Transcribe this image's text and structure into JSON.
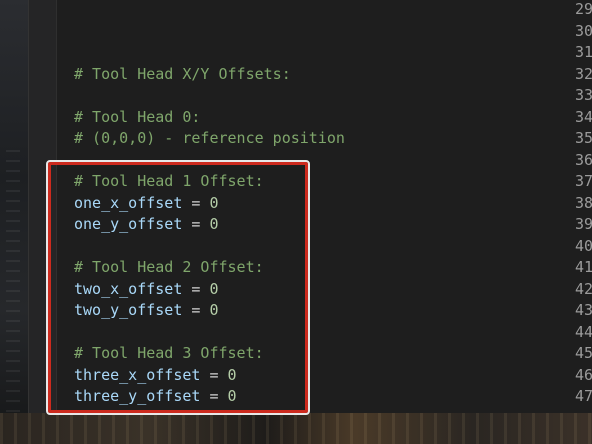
{
  "editor": {
    "lines": [
      {
        "num": "29",
        "kind": "empty",
        "text": ""
      },
      {
        "num": "30",
        "kind": "empty",
        "text": ""
      },
      {
        "num": "31",
        "kind": "empty",
        "text": ""
      },
      {
        "num": "32",
        "kind": "comment",
        "text": "# Tool Head X/Y Offsets:"
      },
      {
        "num": "33",
        "kind": "empty",
        "text": ""
      },
      {
        "num": "34",
        "kind": "comment",
        "text": "# Tool Head 0:"
      },
      {
        "num": "35",
        "kind": "comment",
        "text": "# (0,0,0) - reference position"
      },
      {
        "num": "36",
        "kind": "empty",
        "text": ""
      },
      {
        "num": "37",
        "kind": "comment",
        "text": "# Tool Head 1 Offset:"
      },
      {
        "num": "38",
        "kind": "assign",
        "name": "one_x_offset",
        "op": " = ",
        "value": "0"
      },
      {
        "num": "39",
        "kind": "assign",
        "name": "one_y_offset",
        "op": " = ",
        "value": "0"
      },
      {
        "num": "40",
        "kind": "empty",
        "text": ""
      },
      {
        "num": "41",
        "kind": "comment",
        "text": "# Tool Head 2 Offset:"
      },
      {
        "num": "42",
        "kind": "assign",
        "name": "two_x_offset",
        "op": " = ",
        "value": "0"
      },
      {
        "num": "43",
        "kind": "assign",
        "name": "two_y_offset",
        "op": " = ",
        "value": "0"
      },
      {
        "num": "44",
        "kind": "empty",
        "text": ""
      },
      {
        "num": "45",
        "kind": "comment",
        "text": "# Tool Head 3 Offset:"
      },
      {
        "num": "46",
        "kind": "assign",
        "name": "three_x_offset",
        "op": " = ",
        "value": "0"
      },
      {
        "num": "47",
        "kind": "assign",
        "name": "three_y_offset",
        "op": " = ",
        "value": "0"
      }
    ]
  },
  "colors": {
    "comment": "#7fa66b",
    "identifier": "#a9d8f8",
    "number": "#b5cea8",
    "highlight_border": "#cc2a1e"
  }
}
